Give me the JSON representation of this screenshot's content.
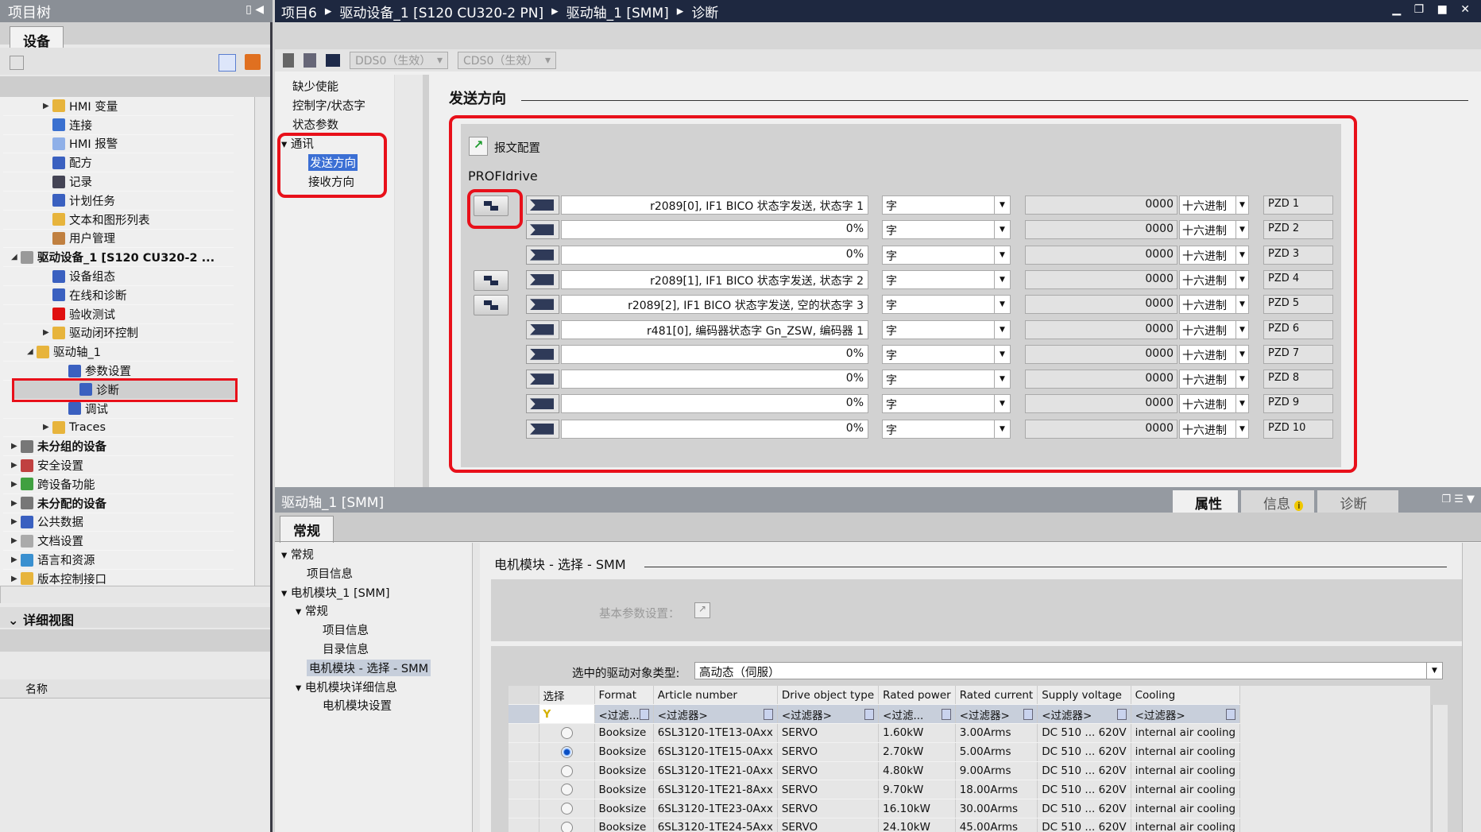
{
  "project_tree": {
    "title": "项目树",
    "tab": "设备",
    "items": [
      {
        "label": "HMI 变量",
        "indent": 3,
        "arrow": "right",
        "color": "#e7b43c"
      },
      {
        "label": "连接",
        "indent": 3,
        "arrow": "",
        "color": "#3a70d0"
      },
      {
        "label": "HMI 报警",
        "indent": 3,
        "arrow": "",
        "color": "#8fb0e8"
      },
      {
        "label": "配方",
        "indent": 3,
        "arrow": "",
        "color": "#3a60c0"
      },
      {
        "label": "记录",
        "indent": 3,
        "arrow": "",
        "color": "#445"
      },
      {
        "label": "计划任务",
        "indent": 3,
        "arrow": "",
        "color": "#3a60c0"
      },
      {
        "label": "文本和图形列表",
        "indent": 3,
        "arrow": "",
        "color": "#e7b43c"
      },
      {
        "label": "用户管理",
        "indent": 3,
        "arrow": "",
        "color": "#c08040"
      },
      {
        "label": "驱动设备_1 [S120 CU320-2 ...",
        "indent": 1,
        "arrow": "down",
        "bold": true,
        "color": "#999"
      },
      {
        "label": "设备组态",
        "indent": 3,
        "arrow": "",
        "color": "#3a60c0"
      },
      {
        "label": "在线和诊断",
        "indent": 3,
        "arrow": "",
        "color": "#3a60c0"
      },
      {
        "label": "验收测试",
        "indent": 3,
        "arrow": "",
        "color": "#e01010"
      },
      {
        "label": "驱动闭环控制",
        "indent": 3,
        "arrow": "right",
        "color": "#e7b43c"
      },
      {
        "label": "驱动轴_1",
        "indent": 2,
        "arrow": "down",
        "color": "#e7b43c"
      },
      {
        "label": "参数设置",
        "indent": 4,
        "arrow": "",
        "color": "#3a60c0"
      },
      {
        "label": "诊断",
        "indent": 4,
        "arrow": "",
        "color": "#3a60c0",
        "selected": true
      },
      {
        "label": "调试",
        "indent": 4,
        "arrow": "",
        "color": "#3a60c0"
      },
      {
        "label": "Traces",
        "indent": 3,
        "arrow": "right",
        "color": "#e7b43c"
      },
      {
        "label": "未分组的设备",
        "indent": 1,
        "arrow": "right",
        "bold": true,
        "color": "#777"
      },
      {
        "label": "安全设置",
        "indent": 1,
        "arrow": "right",
        "color": "#c04040"
      },
      {
        "label": "跨设备功能",
        "indent": 1,
        "arrow": "right",
        "color": "#40a040"
      },
      {
        "label": "未分配的设备",
        "indent": 1,
        "arrow": "right",
        "bold": true,
        "color": "#777"
      },
      {
        "label": "公共数据",
        "indent": 1,
        "arrow": "right",
        "color": "#3a60c0"
      },
      {
        "label": "文档设置",
        "indent": 1,
        "arrow": "right",
        "color": "#aaa"
      },
      {
        "label": "语言和资源",
        "indent": 1,
        "arrow": "right",
        "color": "#3a90d0"
      },
      {
        "label": "版本控制接口",
        "indent": 1,
        "arrow": "right",
        "color": "#e7b43c"
      }
    ]
  },
  "detail_view": {
    "title": "详细视图",
    "column": "名称"
  },
  "breadcrumb": [
    "项目6",
    "驱动设备_1 [S120 CU320-2 PN]",
    "驱动轴_1 [SMM]",
    "诊断"
  ],
  "toolbar": {
    "dds": "DDS0（生效）",
    "cds": "CDS0（生效）"
  },
  "nav": {
    "items": [
      "缺少使能",
      "控制字/状态字",
      "状态参数"
    ],
    "group": "通讯",
    "sub": [
      "发送方向",
      "接收方向"
    ]
  },
  "send": {
    "title": "发送方向",
    "telegram_config": "报文配置",
    "profidrive": "PROFIdrive",
    "rows": [
      {
        "signal": "r2089[0], IF1 BICO 状态字发送, 状态字 1",
        "type": "字",
        "value": "0000",
        "format": "十六进制",
        "pzd": "PZD 1",
        "button": true
      },
      {
        "signal": "0%",
        "type": "字",
        "value": "0000",
        "format": "十六进制",
        "pzd": "PZD 2",
        "button": false
      },
      {
        "signal": "0%",
        "type": "字",
        "value": "0000",
        "format": "十六进制",
        "pzd": "PZD 3",
        "button": false
      },
      {
        "signal": "r2089[1], IF1 BICO 状态字发送, 状态字 2",
        "type": "字",
        "value": "0000",
        "format": "十六进制",
        "pzd": "PZD 4",
        "button": true
      },
      {
        "signal": "r2089[2], IF1 BICO 状态字发送, 空的状态字 3",
        "type": "字",
        "value": "0000",
        "format": "十六进制",
        "pzd": "PZD 5",
        "button": true
      },
      {
        "signal": "r481[0], 编码器状态字 Gn_ZSW, 编码器 1",
        "type": "字",
        "value": "0000",
        "format": "十六进制",
        "pzd": "PZD 6",
        "button": false
      },
      {
        "signal": "0%",
        "type": "字",
        "value": "0000",
        "format": "十六进制",
        "pzd": "PZD 7",
        "button": false
      },
      {
        "signal": "0%",
        "type": "字",
        "value": "0000",
        "format": "十六进制",
        "pzd": "PZD 8",
        "button": false
      },
      {
        "signal": "0%",
        "type": "字",
        "value": "0000",
        "format": "十六进制",
        "pzd": "PZD 9",
        "button": false
      },
      {
        "signal": "0%",
        "type": "字",
        "value": "0000",
        "format": "十六进制",
        "pzd": "PZD 10",
        "button": false
      }
    ]
  },
  "inspector": {
    "title": "驱动轴_1 [SMM]",
    "tabs": [
      "属性",
      "信息",
      "诊断"
    ],
    "sub_tab": "常规",
    "nav": [
      {
        "label": "常规",
        "level": 0,
        "arrow": true
      },
      {
        "label": "项目信息",
        "level": 1
      },
      {
        "label": "电机模块_1 [SMM]",
        "level": 0,
        "arrow": true
      },
      {
        "label": "常规",
        "level": 1,
        "arrow": true
      },
      {
        "label": "项目信息",
        "level": 2
      },
      {
        "label": "目录信息",
        "level": 2
      },
      {
        "label": "电机模块 - 选择 - SMM",
        "level": 1,
        "selected": true
      },
      {
        "label": "电机模块详细信息",
        "level": 1,
        "arrow": true
      },
      {
        "label": "电机模块设置",
        "level": 2
      }
    ],
    "section_title": "电机模块 - 选择 - SMM",
    "basic_params": "基本参数设置：",
    "drive_type_label": "选中的驱动对象类型:",
    "drive_type_value": "高动态（伺服）",
    "table": {
      "headers": [
        "选择",
        "Format",
        "Article number",
        "Drive object type",
        "Rated power",
        "Rated current",
        "Supply voltage",
        "Cooling"
      ],
      "filters": [
        "<过滤...",
        "<过滤器>",
        "<过滤器>",
        "<过滤...",
        "<过滤器>",
        "<过滤器>",
        "<过滤器>"
      ],
      "rows": [
        {
          "selected": false,
          "cells": [
            "Booksize",
            "6SL3120-1TE13-0Axx",
            "SERVO",
            "1.60kW",
            "3.00Arms",
            "DC 510 ... 620V",
            "internal air cooling"
          ]
        },
        {
          "selected": true,
          "cells": [
            "Booksize",
            "6SL3120-1TE15-0Axx",
            "SERVO",
            "2.70kW",
            "5.00Arms",
            "DC 510 ... 620V",
            "internal air cooling"
          ]
        },
        {
          "selected": false,
          "cells": [
            "Booksize",
            "6SL3120-1TE21-0Axx",
            "SERVO",
            "4.80kW",
            "9.00Arms",
            "DC 510 ... 620V",
            "internal air cooling"
          ]
        },
        {
          "selected": false,
          "cells": [
            "Booksize",
            "6SL3120-1TE21-8Axx",
            "SERVO",
            "9.70kW",
            "18.00Arms",
            "DC 510 ... 620V",
            "internal air cooling"
          ]
        },
        {
          "selected": false,
          "cells": [
            "Booksize",
            "6SL3120-1TE23-0Axx",
            "SERVO",
            "16.10kW",
            "30.00Arms",
            "DC 510 ... 620V",
            "internal air cooling"
          ]
        },
        {
          "selected": false,
          "cells": [
            "Booksize",
            "6SL3120-1TE24-5Axx",
            "SERVO",
            "24.10kW",
            "45.00Arms",
            "DC 510 ... 620V",
            "internal air cooling"
          ]
        }
      ]
    }
  },
  "colors": {
    "highlight_red": "#e8101a",
    "title_bar": "#1e2840",
    "selection": "#3b6fd4"
  }
}
